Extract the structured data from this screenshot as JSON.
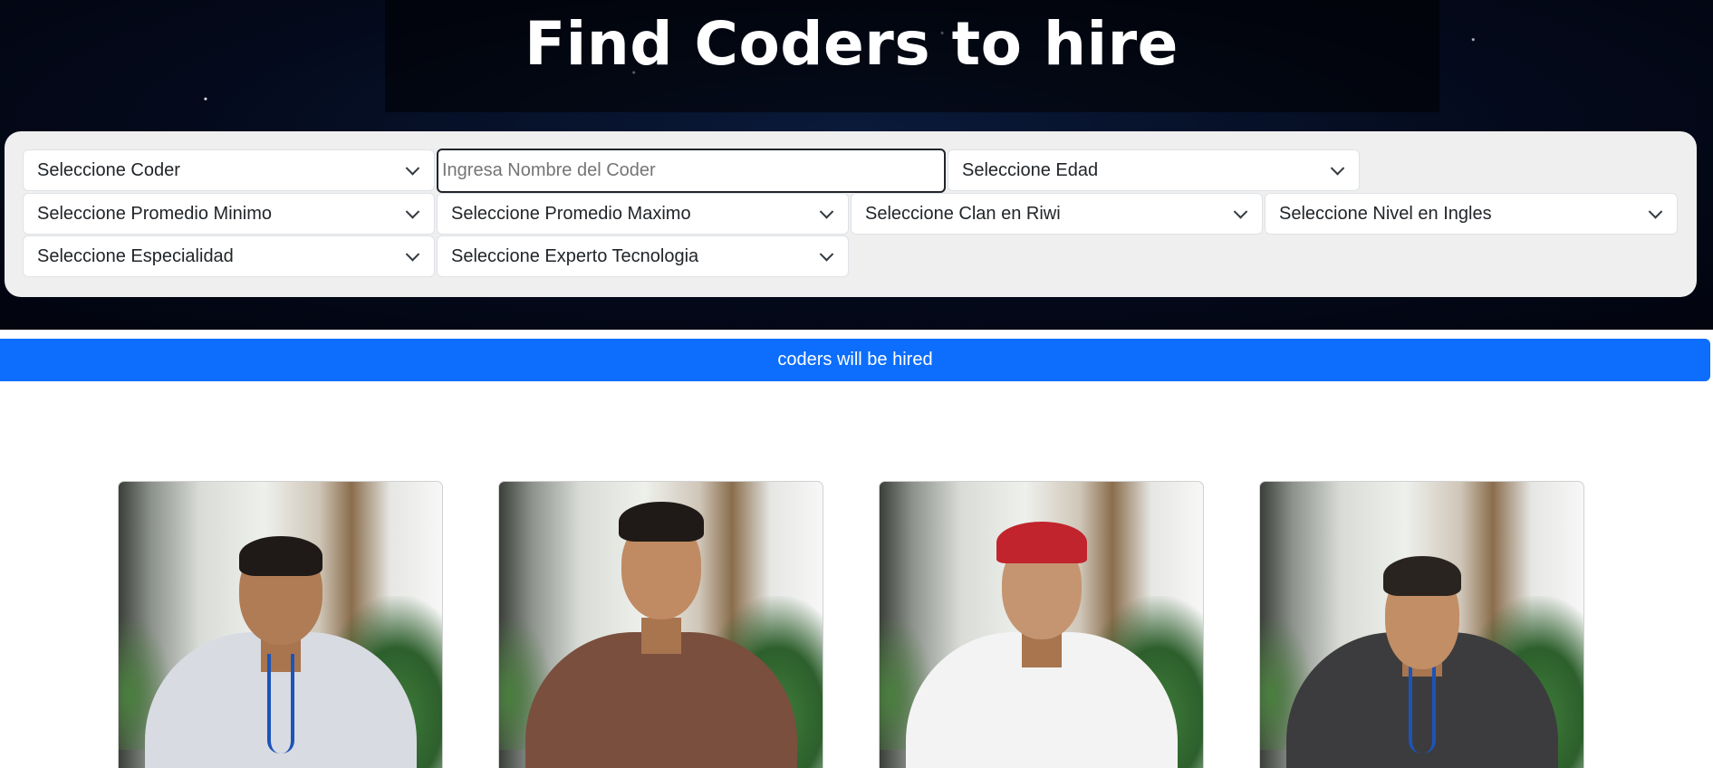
{
  "header": {
    "title": "Find Coders to hire"
  },
  "filters": {
    "coder_select": "Seleccione Coder",
    "name_input_placeholder": "Ingresa Nombre del Coder",
    "age_select": "Seleccione Edad",
    "min_avg_select": "Seleccione Promedio Minimo",
    "max_avg_select": "Seleccione Promedio Maximo",
    "clan_select": "Seleccione Clan en Riwi",
    "english_select": "Seleccione Nivel en Ingles",
    "specialty_select": "Seleccione Especialidad",
    "tech_expert_select": "Seleccione Experto Tecnologia"
  },
  "banner": {
    "text": "coders will be hired"
  },
  "colors": {
    "accent": "#0d6efd",
    "panel": "#efefef",
    "hero_bg": "#040a1c"
  },
  "cards": [
    {
      "photo": "coder-photo-1"
    },
    {
      "photo": "coder-photo-2"
    },
    {
      "photo": "coder-photo-3"
    },
    {
      "photo": "coder-photo-4"
    }
  ]
}
